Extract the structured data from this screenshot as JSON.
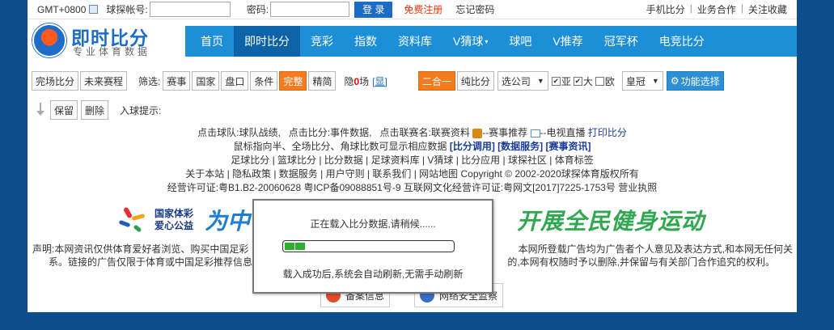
{
  "topbar": {
    "timezone": "GMT+0800",
    "account_label": "球探帐号:",
    "account_value": "",
    "password_label": "密码:",
    "password_value": "",
    "login_label": "登 录",
    "register_label": "免费注册",
    "forgot_label": "忘记密码",
    "links": [
      "手机比分",
      "业务合作",
      "关注收藏"
    ]
  },
  "logo": {
    "title": "即时比分",
    "subtitle": "专业体育数据"
  },
  "nav": {
    "items": [
      "首页",
      "即时比分",
      "竞彩",
      "指数",
      "资料库",
      "V猜球",
      "球吧",
      "V推荐",
      "冠军杯",
      "电竞比分"
    ],
    "active_index": 1
  },
  "filterbar": {
    "btn_complete": "完场比分",
    "btn_future": "未来赛程",
    "filter_label": "筛选:",
    "filters": [
      "赛事",
      "国家",
      "盘口",
      "条件"
    ],
    "btn_full": "完整",
    "btn_simple": "精简",
    "hidden_prefix": "隐",
    "hidden_count": "0",
    "hidden_suffix": "场",
    "show_link": "[显]",
    "btn_combo": "二合一",
    "btn_pure": "纯比分",
    "company_select": "选公司",
    "check_ya": "亚",
    "check_da": "大",
    "check_ou": "欧",
    "crown_select": "皇冠",
    "func_btn": "功能选择"
  },
  "goalbar": {
    "keep": "保留",
    "delete": "删除",
    "tip": "入球提示:"
  },
  "info": {
    "line1_a": "点击球队:球队战绩,",
    "line1_b": "点击比分:事件数据,",
    "line1_c": "点击联赛名:联赛资料",
    "line1_d": "--赛事推荐",
    "line1_e": "--电视直播",
    "line1_link": "打印比分",
    "line2_text": "鼠标指向半、全场比分、角球比数可显示相应数据",
    "line2_links": [
      "[比分调用]",
      "[数据服务]",
      "[赛事资讯]"
    ],
    "line3": "足球比分 | 篮球比分 | 比分数据 | 足球资料库 | V猜球 | 比分应用 | 球探社区 | 体育标签",
    "line4": "关于本站 | 隐私政策 | 数据服务 | 用户守则 | 联系我们 | 网站地图 Copyright © 2002-2020球探体育版权所有",
    "line5": "经营许可证:粤B1.B2-20060628 粤ICP备09088851号-9 互联网文化经营许可证:粤网文[2017]7225-1753号 营业执照"
  },
  "banner": {
    "brand_line1": "国家体彩",
    "brand_line2": "爱心公益",
    "left_text": "为中",
    "right_text": "开展全民健身运动"
  },
  "disclaimer": {
    "l1_left": "声明:本网资讯仅供体育爱好者浏览、购买中国足彩",
    "l1_right": "本网所登载广告均为广告者个人意见及表达方式,和本网无任何关",
    "l2_left": "系。链接的广告仅限于体育或中国足彩推荐信息、",
    "l2_right": "的,本网有权随时予以删除,并保留与有关部门合作追究的权利。"
  },
  "badges": [
    "备案信息",
    "网络安全监察"
  ],
  "dialog": {
    "loading": "正在载入比分数据,请稍候......",
    "progress": 0.12,
    "note": "载入成功后,系统会自动刷新,无需手动刷新"
  },
  "colors": {
    "nav": "#1d8ed8",
    "nav_active": "#0d62a8",
    "orange": "#f47c1e",
    "page_bg": "#0d4d8b",
    "progress": "#2fae2f"
  }
}
